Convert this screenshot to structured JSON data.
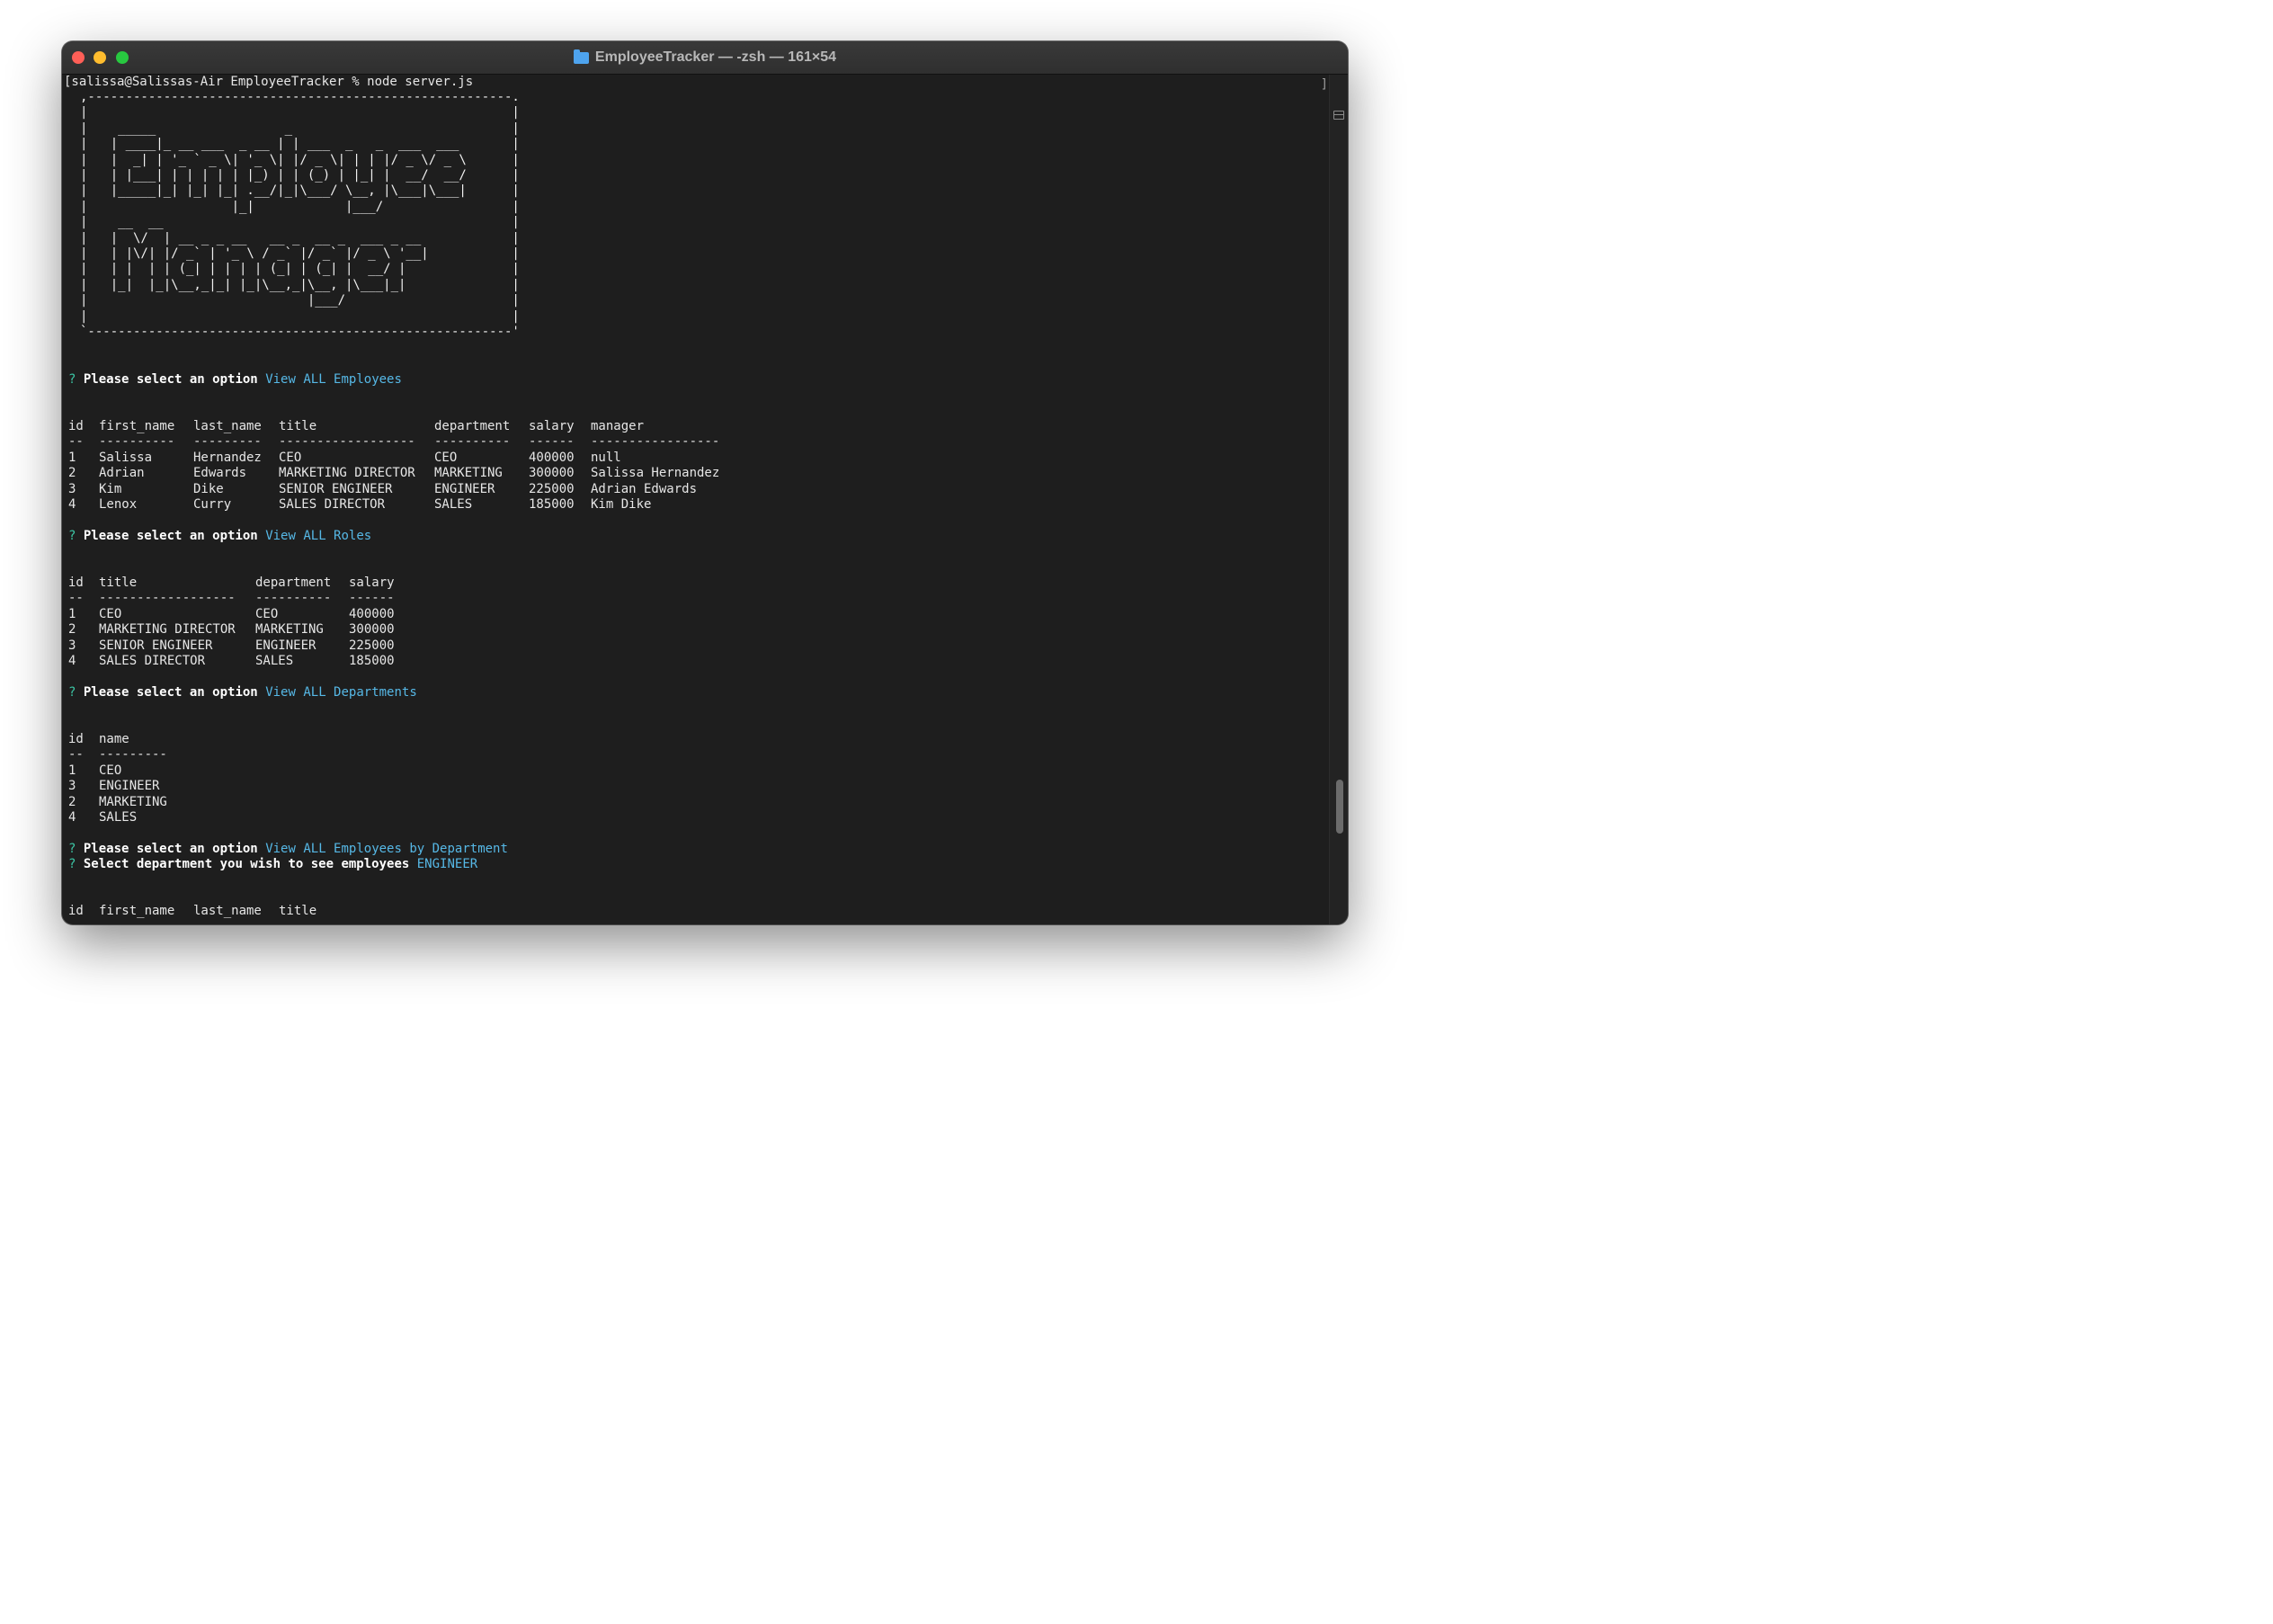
{
  "window": {
    "title": "EmployeeTracker — -zsh — 161×54",
    "folder_icon": "folder-icon"
  },
  "terminal": {
    "command_line": "[salissa@Salissas-Air EmployeeTracker % node server.js",
    "banner_ascii": ",--------------------------------------------------------.\n|                                                        |\n|    _____                 _                             |\n|   | ____|_ __ ___  _ __ | | ___  _   _  ___  ___       |\n|   |  _| | '_ ` _ \\| '_ \\| |/ _ \\| | | |/ _ \\/ _ \\      |\n|   | |___| | | | | | |_) | | (_) | |_| |  __/  __/      |\n|   |_____|_| |_| |_| .__/|_|\\___/ \\__, |\\___|\\___|      |\n|                   |_|            |___/                 |\n|    __  __                                              |\n|   |  \\/  | __ _ _ __   __ _  __ _  ___ _ __            |\n|   | |\\/| |/ _` | '_ \\ / _` |/ _` |/ _ \\ '__|           |\n|   | |  | | (_| | | | | (_| | (_| |  __/ |              |\n|   |_|  |_|\\__,_|_| |_|\\__,_|\\__, |\\___|_|              |\n|                             |___/                      |\n|                                                        |\n`--------------------------------------------------------'",
    "prompt_mark": "?",
    "prompt_label": "Please select an option",
    "dept_prompt_label": "Select department you wish to see employees",
    "answers": {
      "q1": "View ALL Employees",
      "q2": "View ALL Roles",
      "q3": "View ALL Departments",
      "q4": "View ALL Employees by Department",
      "q5": "ENGINEER"
    },
    "employees_table": {
      "headers": [
        "id",
        "first_name",
        "last_name",
        "title",
        "department",
        "salary",
        "manager"
      ],
      "separators": [
        "--",
        "----------",
        "---------",
        "------------------",
        "----------",
        "------",
        "-----------------"
      ],
      "rows": [
        [
          "1",
          "Salissa",
          "Hernandez",
          "CEO",
          "CEO",
          "400000",
          "null"
        ],
        [
          "2",
          "Adrian",
          "Edwards",
          "MARKETING DIRECTOR",
          "MARKETING",
          "300000",
          "Salissa Hernandez"
        ],
        [
          "3",
          "Kim",
          "Dike",
          "SENIOR ENGINEER",
          "ENGINEER",
          "225000",
          "Adrian Edwards"
        ],
        [
          "4",
          "Lenox",
          "Curry",
          "SALES DIRECTOR",
          "SALES",
          "185000",
          "Kim Dike"
        ]
      ]
    },
    "roles_table": {
      "headers": [
        "id",
        "title",
        "department",
        "salary"
      ],
      "separators": [
        "--",
        "------------------",
        "----------",
        "------"
      ],
      "rows": [
        [
          "1",
          "CEO",
          "CEO",
          "400000"
        ],
        [
          "2",
          "MARKETING DIRECTOR",
          "MARKETING",
          "300000"
        ],
        [
          "3",
          "SENIOR ENGINEER",
          "ENGINEER",
          "225000"
        ],
        [
          "4",
          "SALES DIRECTOR",
          "SALES",
          "185000"
        ]
      ]
    },
    "departments_table": {
      "headers": [
        "id",
        "name"
      ],
      "separators": [
        "--",
        "---------"
      ],
      "rows": [
        [
          "1",
          "CEO"
        ],
        [
          "3",
          "ENGINEER"
        ],
        [
          "2",
          "MARKETING"
        ],
        [
          "4",
          "SALES"
        ]
      ]
    },
    "dept_employees_table": {
      "headers": [
        "id",
        "first_name",
        "last_name",
        "title"
      ]
    }
  },
  "colors": {
    "prompt_mark": "#3cc6a5",
    "answer": "#56b8e6",
    "background": "#1e1e1e"
  }
}
